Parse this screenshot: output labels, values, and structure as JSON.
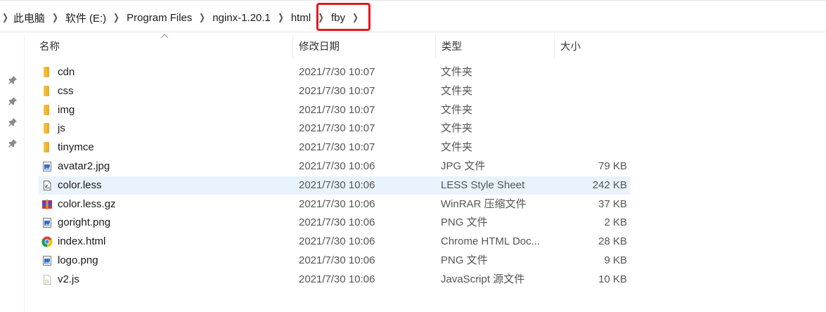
{
  "breadcrumb": {
    "items": [
      "此电脑",
      "软件 (E:)",
      "Program Files",
      "nginx-1.20.1",
      "html",
      "fby"
    ]
  },
  "columns": {
    "name": "名称",
    "date": "修改日期",
    "type": "类型",
    "size": "大小"
  },
  "files": [
    {
      "name": "cdn",
      "date": "2021/7/30 10:07",
      "type": "文件夹",
      "size": "",
      "icon": "folder-icon"
    },
    {
      "name": "css",
      "date": "2021/7/30 10:07",
      "type": "文件夹",
      "size": "",
      "icon": "folder-icon"
    },
    {
      "name": "img",
      "date": "2021/7/30 10:07",
      "type": "文件夹",
      "size": "",
      "icon": "folder-icon"
    },
    {
      "name": "js",
      "date": "2021/7/30 10:07",
      "type": "文件夹",
      "size": "",
      "icon": "folder-icon"
    },
    {
      "name": "tinymce",
      "date": "2021/7/30 10:07",
      "type": "文件夹",
      "size": "",
      "icon": "folder-icon"
    },
    {
      "name": "avatar2.jpg",
      "date": "2021/7/30 10:06",
      "type": "JPG 文件",
      "size": "79 KB",
      "icon": "image-file-icon"
    },
    {
      "name": "color.less",
      "date": "2021/7/30 10:06",
      "type": "LESS Style Sheet",
      "size": "242 KB",
      "icon": "text-file-icon"
    },
    {
      "name": "color.less.gz",
      "date": "2021/7/30 10:06",
      "type": "WinRAR 压缩文件",
      "size": "37 KB",
      "icon": "archive-file-icon"
    },
    {
      "name": "goright.png",
      "date": "2021/7/30 10:06",
      "type": "PNG 文件",
      "size": "2 KB",
      "icon": "image-file-icon"
    },
    {
      "name": "index.html",
      "date": "2021/7/30 10:06",
      "type": "Chrome HTML Doc...",
      "size": "28 KB",
      "icon": "chrome-icon"
    },
    {
      "name": "logo.png",
      "date": "2021/7/30 10:06",
      "type": "PNG 文件",
      "size": "9 KB",
      "icon": "image-file-icon"
    },
    {
      "name": "v2.js",
      "date": "2021/7/30 10:06",
      "type": "JavaScript 源文件",
      "size": "10 KB",
      "icon": "js-file-icon"
    }
  ],
  "selected_file": "color.less",
  "colors": {
    "highlight_box": "#e0191e",
    "selected_row": "#e9f3fd",
    "folder": "#f0b93a"
  }
}
